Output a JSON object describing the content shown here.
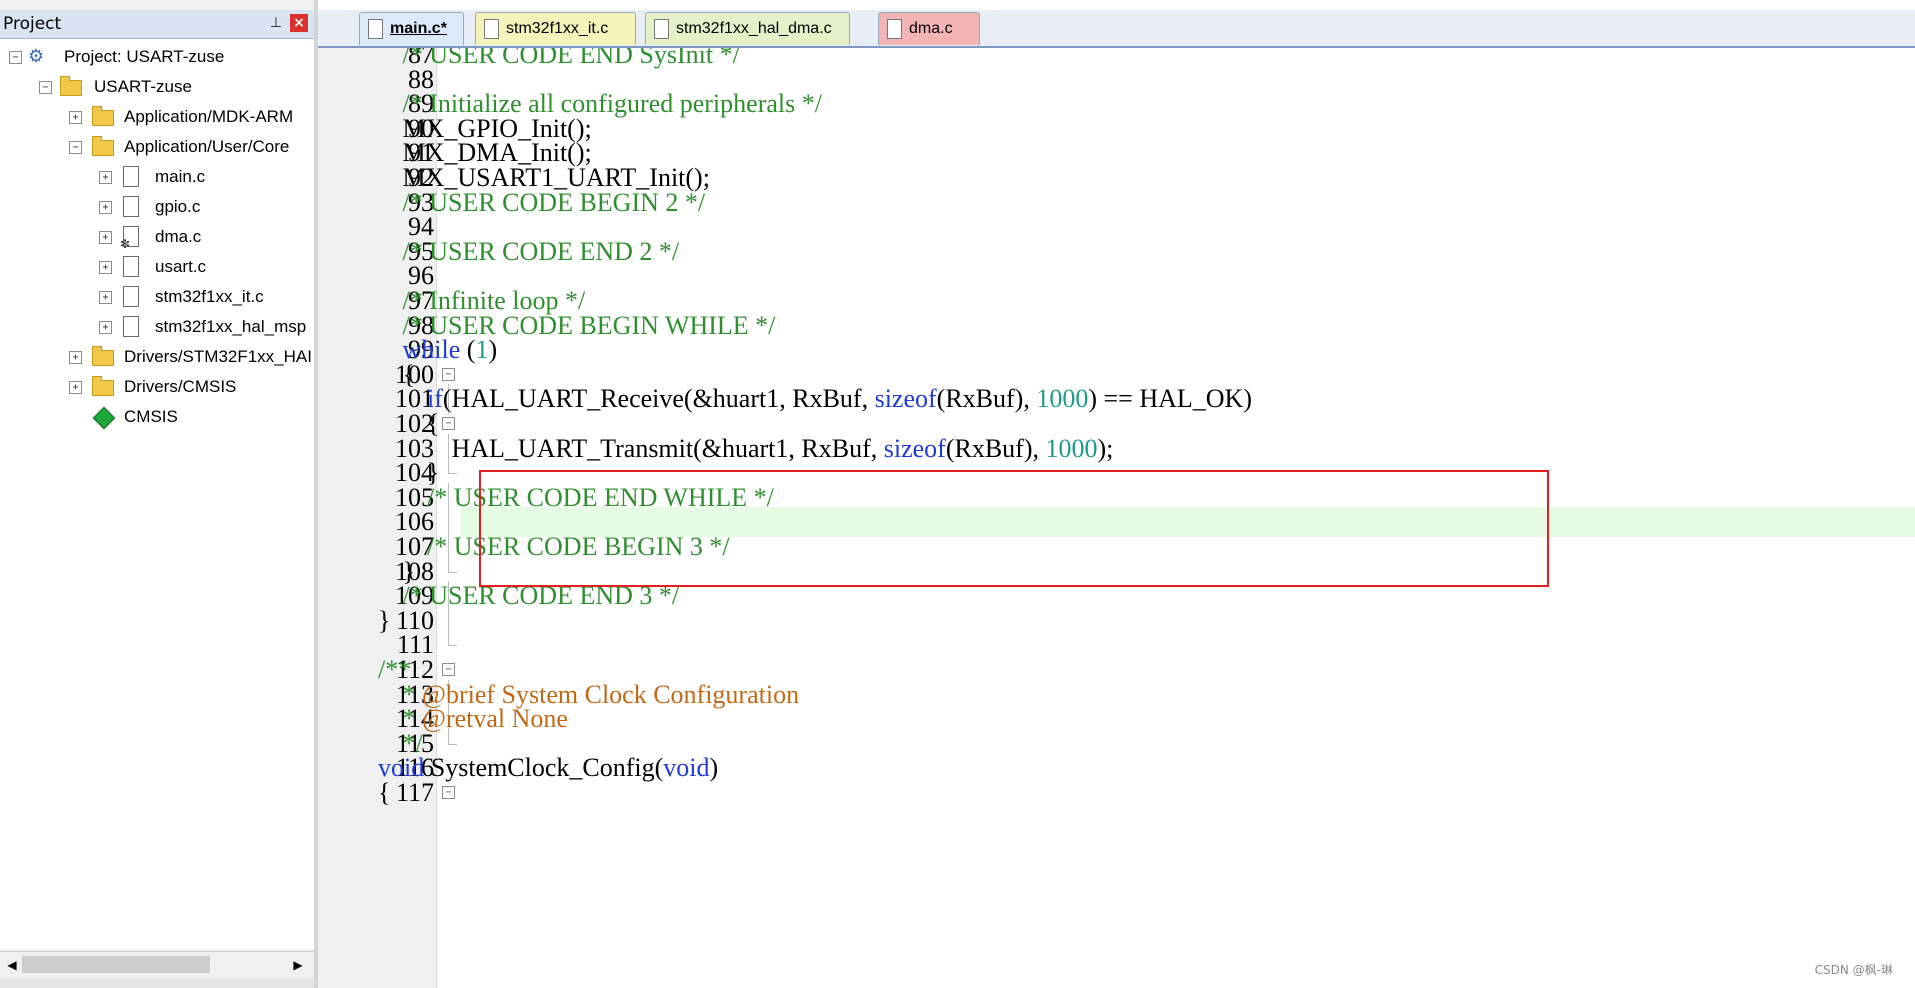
{
  "project_panel": {
    "title": "Project",
    "pin_icon": "pin-icon",
    "close_icon": "close-icon",
    "tree": [
      {
        "label": "Project: USART-zuse",
        "icon": "project-icon",
        "expander": "⊟"
      },
      {
        "label": "USART-zuse",
        "icon": "target-folder-icon",
        "expander": "⊟"
      },
      {
        "label": "Application/MDK-ARM",
        "icon": "folder-icon",
        "expander": "+"
      },
      {
        "label": "Application/User/Core",
        "icon": "open-folder-icon",
        "expander": "−"
      },
      {
        "label": "main.c",
        "icon": "file-icon",
        "expander": "+"
      },
      {
        "label": "gpio.c",
        "icon": "file-icon",
        "expander": "+"
      },
      {
        "label": "dma.c",
        "icon": "file-gear-icon",
        "expander": "+"
      },
      {
        "label": "usart.c",
        "icon": "file-icon",
        "expander": "+"
      },
      {
        "label": "stm32f1xx_it.c",
        "icon": "file-icon",
        "expander": "+"
      },
      {
        "label": "stm32f1xx_hal_msp",
        "icon": "file-icon",
        "expander": "+"
      },
      {
        "label": "Drivers/STM32F1xx_HAI",
        "icon": "folder-icon",
        "expander": "+"
      },
      {
        "label": "Drivers/CMSIS",
        "icon": "folder-icon",
        "expander": "+"
      },
      {
        "label": "CMSIS",
        "icon": "cmsis-diamond-icon",
        "expander": ""
      }
    ]
  },
  "tabs": [
    {
      "label": "main.c*",
      "active": true
    },
    {
      "label": "stm32f1xx_it.c",
      "active": false
    },
    {
      "label": "stm32f1xx_hal_dma.c",
      "active": false
    },
    {
      "label": "dma.c",
      "active": false
    }
  ],
  "editor": {
    "highlighted_line": 106,
    "lines": [
      {
        "n": "87",
        "text": "/* USER CODE END SysInit */"
      },
      {
        "n": "88",
        "text": ""
      },
      {
        "n": "89",
        "text": "/* Initialize all configured peripherals */"
      },
      {
        "n": "90",
        "text": "MX_GPIO_Init();"
      },
      {
        "n": "91",
        "text": "MX_DMA_Init();"
      },
      {
        "n": "92",
        "text": "MX_USART1_UART_Init();"
      },
      {
        "n": "93",
        "text": "/* USER CODE BEGIN 2 */"
      },
      {
        "n": "94",
        "text": ""
      },
      {
        "n": "95",
        "text": "/* USER CODE END 2 */"
      },
      {
        "n": "96",
        "text": ""
      },
      {
        "n": "97",
        "text": "/* Infinite loop */"
      },
      {
        "n": "98",
        "text": "/* USER CODE BEGIN WHILE */"
      },
      {
        "n": "99",
        "text": "while (1)"
      },
      {
        "n": "100",
        "text": "{"
      },
      {
        "n": "101",
        "text": "if(HAL_UART_Receive(&huart1, RxBuf, sizeof(RxBuf), 1000) == HAL_OK)"
      },
      {
        "n": "102",
        "text": "{"
      },
      {
        "n": "103",
        "text": "HAL_UART_Transmit(&huart1, RxBuf, sizeof(RxBuf), 1000);"
      },
      {
        "n": "104",
        "text": "}"
      },
      {
        "n": "105",
        "text": "/* USER CODE END WHILE */"
      },
      {
        "n": "106",
        "text": ""
      },
      {
        "n": "107",
        "text": "/* USER CODE BEGIN 3 */"
      },
      {
        "n": "108",
        "text": "}"
      },
      {
        "n": "109",
        "text": "/* USER CODE END 3 */"
      },
      {
        "n": "110",
        "text": "}"
      },
      {
        "n": "111",
        "text": ""
      },
      {
        "n": "112",
        "text": "/**"
      },
      {
        "n": "113",
        "text": "* @brief System Clock Configuration"
      },
      {
        "n": "114",
        "text": "* @retval None"
      },
      {
        "n": "115",
        "text": "*/"
      },
      {
        "n": "116",
        "text": "void SystemClock_Config(void)"
      },
      {
        "n": "117",
        "text": "{"
      }
    ]
  },
  "colors": {
    "comment": "#2f8f2f",
    "keyword": "#1e3ad3",
    "number": "#1f9a8a",
    "doc_tag": "#c06a18",
    "highlight_red": "#e02020",
    "current_line": "#e6fbe3"
  },
  "watermark": "CSDN @枫-琳"
}
